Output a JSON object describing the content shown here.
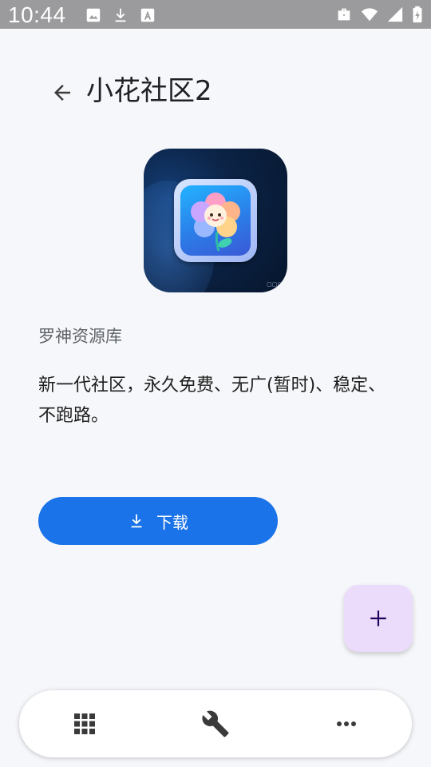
{
  "status_bar": {
    "time": "10:44",
    "left_icons": [
      "image-icon",
      "download-icon",
      "font-icon"
    ],
    "right_icons": [
      "briefcase-icon",
      "wifi-icon",
      "signal-icon",
      "battery-icon"
    ]
  },
  "header": {
    "back_icon": "arrow-left-icon",
    "title": "小花社区2"
  },
  "app": {
    "icon": "flower-app-icon",
    "author": "罗神资源库",
    "description": "新一代社区，永久免费、无广(暂时)、稳定、不跑路。",
    "download_label": "下载",
    "download_icon": "download-icon"
  },
  "fab": {
    "icon": "plus-icon"
  },
  "bottom_nav": {
    "items": [
      {
        "icon": "apps-grid-icon"
      },
      {
        "icon": "wrench-icon"
      },
      {
        "icon": "more-horizontal-icon"
      }
    ]
  },
  "colors": {
    "background": "#f6f7fa",
    "status_bar": "#9b9b9d",
    "accent": "#1a73e8",
    "fab": "#ebdcfb"
  }
}
